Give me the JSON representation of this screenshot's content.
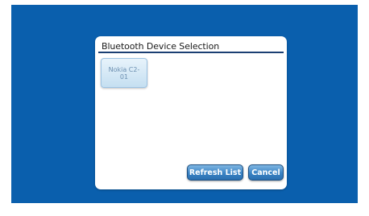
{
  "dialog": {
    "title": "Bluetooth Device Selection",
    "devices": [
      {
        "label": "Nokia C2-01"
      }
    ],
    "refresh_label": "Refresh List",
    "cancel_label": "Cancel"
  },
  "colors": {
    "background": "#0a5fad",
    "dialog": "#ffffff",
    "title_rule": "#1b3f73",
    "button": "#3a83c4",
    "device_tile": "#d6e9f6"
  }
}
